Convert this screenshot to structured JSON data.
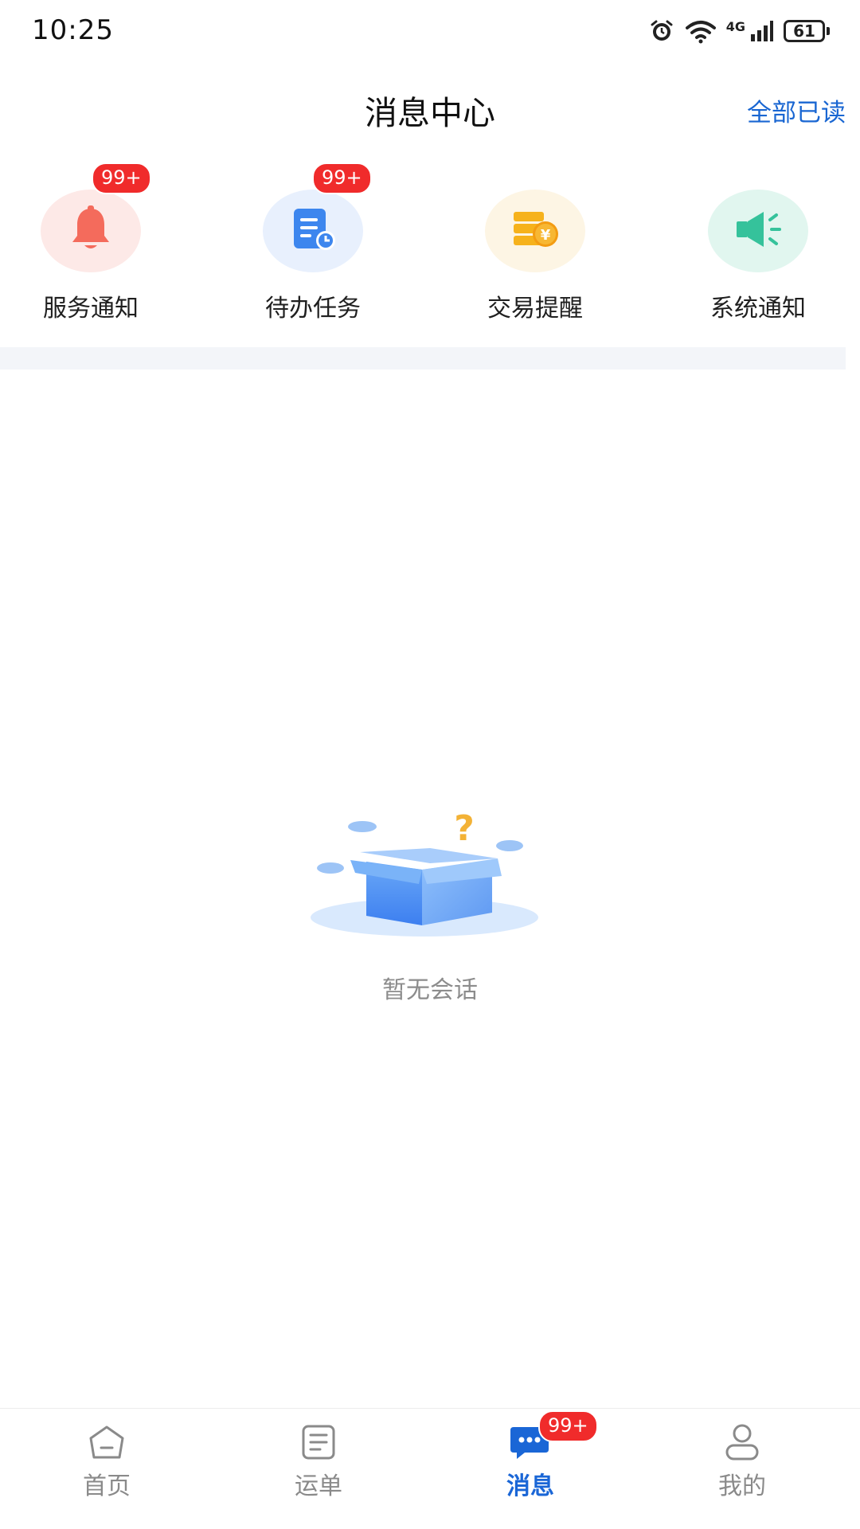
{
  "status_bar": {
    "time": "10:25",
    "network": "4G",
    "battery": "61"
  },
  "header": {
    "title": "消息中心",
    "mark_all_read": "全部已读"
  },
  "categories": [
    {
      "label": "服务通知",
      "icon": "bell-icon",
      "badge": "99+",
      "color": "#f46b5c",
      "bg": "#fde9e7"
    },
    {
      "label": "待办任务",
      "icon": "task-list-icon",
      "badge": "99+",
      "color": "#3d86ee",
      "bg": "#e8f0fd"
    },
    {
      "label": "交易提醒",
      "icon": "coin-stack-icon",
      "badge": "",
      "color": "#f6b21c",
      "bg": "#fdf5e4"
    },
    {
      "label": "系统通知",
      "icon": "speaker-icon",
      "badge": "",
      "color": "#35c29b",
      "bg": "#e1f6ef"
    }
  ],
  "empty_state": {
    "text": "暂无会话",
    "illustration": "empty-box-illustration"
  },
  "bottom_nav": {
    "items": [
      {
        "label": "首页",
        "icon": "home-icon",
        "active": false
      },
      {
        "label": "运单",
        "icon": "waybill-icon",
        "active": false
      },
      {
        "label": "消息",
        "icon": "chat-icon",
        "active": true,
        "badge": "99+"
      },
      {
        "label": "我的",
        "icon": "profile-icon",
        "active": false
      }
    ]
  },
  "colors": {
    "accent": "#1a66d6",
    "badge": "#f02b2b"
  }
}
